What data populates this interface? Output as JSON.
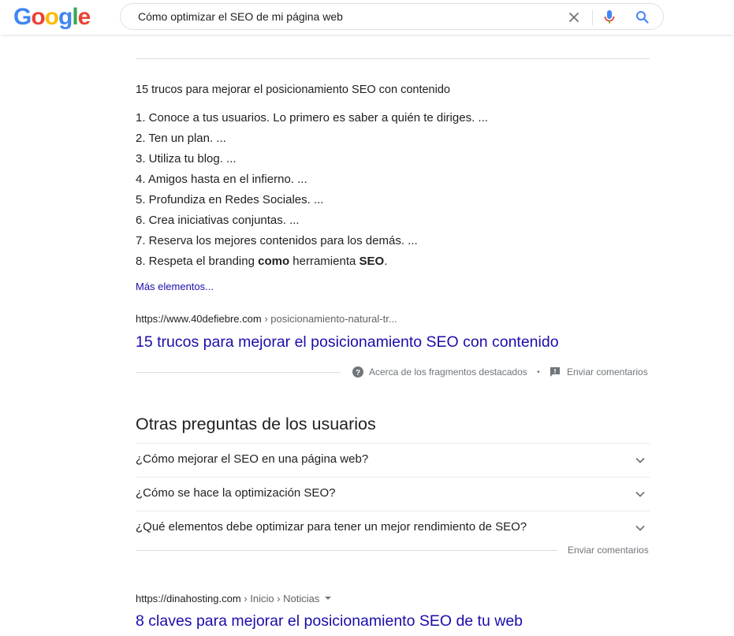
{
  "header": {
    "logo_letters": [
      "G",
      "o",
      "o",
      "g",
      "l",
      "e"
    ],
    "search_value": "Cómo optimizar el SEO de mi página web"
  },
  "snippet": {
    "title": "15 trucos para mejorar el posicionamiento SEO con contenido",
    "items": [
      "1. Conoce a tus usuarios. Lo primero es saber a quién te diriges. ...",
      "2. Ten un plan. ...",
      "3. Utiliza tu blog. ...",
      "4. Amigos hasta en el infierno. ...",
      "5. Profundiza en Redes Sociales. ...",
      "6. Crea iniciativas conjuntas. ...",
      "7. Reserva los mejores contenidos para los demás. ..."
    ],
    "item8": {
      "a": "8. Respeta el branding ",
      "b": "como",
      "c": " herramienta ",
      "d": "SEO",
      "e": "."
    },
    "more": "Más elementos...",
    "cite_domain": "https://www.40defiebre.com",
    "cite_path": " › posicionamiento-natural-tr...",
    "result_title": "15 trucos para mejorar el posicionamiento SEO con contenido",
    "about": "Acerca de los fragmentos destacados",
    "dot": "•",
    "feedback": "Enviar comentarios"
  },
  "paa": {
    "heading": "Otras preguntas de los usuarios",
    "questions": [
      "¿Cómo mejorar el SEO en una página web?",
      "¿Cómo se hace la optimización SEO?",
      "¿Qué elementos debe optimizar para tener un mejor rendimiento de SEO?"
    ],
    "feedback": "Enviar comentarios"
  },
  "result2": {
    "cite_domain": "https://dinahosting.com",
    "cite_path": " › Inicio › Noticias",
    "title": "8 claves para mejorar el posicionamiento SEO de tu web"
  },
  "colors": {
    "link": "#1a0dab",
    "google_blue": "#4285F4",
    "google_red": "#EA4335",
    "google_yellow": "#FBBC05",
    "google_green": "#34A853"
  }
}
